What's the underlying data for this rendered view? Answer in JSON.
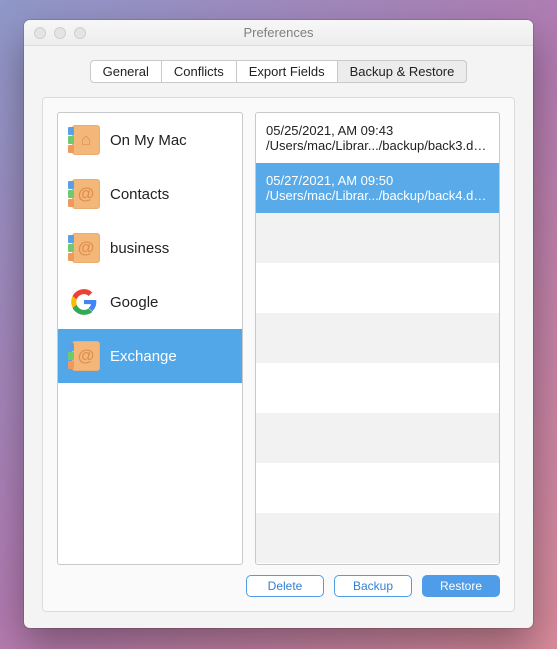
{
  "window": {
    "title": "Preferences"
  },
  "tabs": [
    {
      "label": "General",
      "active": false
    },
    {
      "label": "Conflicts",
      "active": false
    },
    {
      "label": "Export Fields",
      "active": false
    },
    {
      "label": "Backup & Restore",
      "active": true
    }
  ],
  "accounts": [
    {
      "label": "On My Mac",
      "icon": "home",
      "selected": false
    },
    {
      "label": "Contacts",
      "icon": "at",
      "selected": false
    },
    {
      "label": "business",
      "icon": "at",
      "selected": false
    },
    {
      "label": "Google",
      "icon": "google",
      "selected": false
    },
    {
      "label": "Exchange",
      "icon": "at",
      "selected": true
    }
  ],
  "backups": [
    {
      "date": "05/25/2021, AM 09:43",
      "path": "/Users/mac/Librar.../backup/back3.data",
      "selected": false
    },
    {
      "date": "05/27/2021, AM 09:50",
      "path": "/Users/mac/Librar.../backup/back4.data",
      "selected": true
    }
  ],
  "buttons": {
    "delete": "Delete",
    "backup": "Backup",
    "restore": "Restore"
  }
}
